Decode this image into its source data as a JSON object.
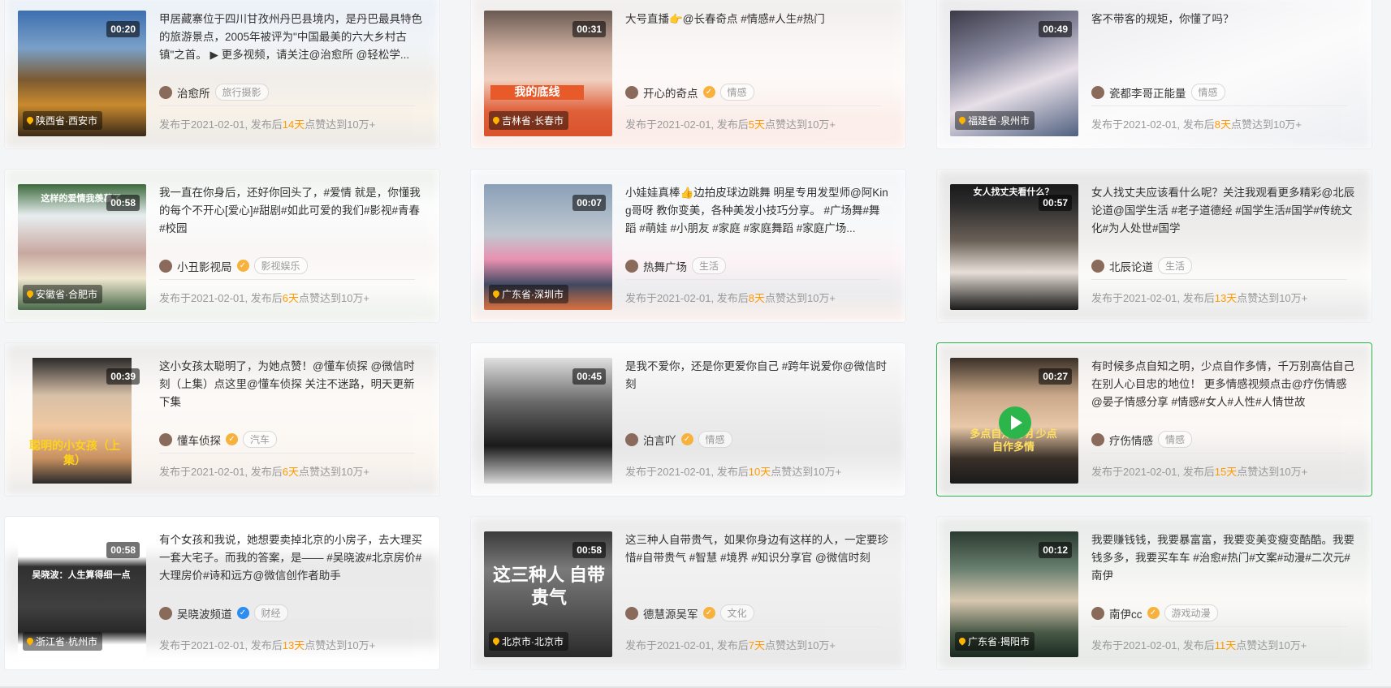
{
  "colors": {
    "accent_green": "#2bb54b",
    "highlight_orange": "#ff9900",
    "location_pin": "#ffb400",
    "verified_gold": "#f6b23c",
    "verified_blue": "#2d8cf0"
  },
  "icons": {
    "location": "location-pin-icon",
    "verified": "verified-badge-icon",
    "play": "play-icon"
  },
  "cards": [
    {
      "duration": "00:20",
      "location": "陕西省·西安市",
      "title": "甲居藏寨位于四川甘孜州丹巴县境内，是丹巴最具特色的旅游景点，2005年被评为\"中国最美的六大乡村古镇\"之首。 ▶ 更多视频，请关注@治愈所 @轻松学...",
      "author": "治愈所",
      "verified": "",
      "tag": "旅行摄影",
      "meta_pre": "发布于2021-02-01, 发布后",
      "days": "14天",
      "meta_post": "点赞达到10万+",
      "thumb_text": ""
    },
    {
      "duration": "00:31",
      "location": "吉林省·长春市",
      "title": "大号直播👉@长春奇点 #情感#人生#热门",
      "author": "开心的奇点",
      "verified": "gold",
      "tag": "情感",
      "meta_pre": "发布于2021-02-01, 发布后",
      "days": "5天",
      "meta_post": "点赞达到10万+",
      "thumb_text": "我的底线"
    },
    {
      "duration": "00:49",
      "location": "福建省·泉州市",
      "title": "客不带客的规矩，你懂了吗？",
      "author": "瓷都李哥正能量",
      "verified": "",
      "tag": "情感",
      "meta_pre": "发布于2021-02-01, 发布后",
      "days": "8天",
      "meta_post": "点赞达到10万+",
      "thumb_text": ""
    },
    {
      "duration": "00:58",
      "location": "安徽省·合肥市",
      "title": "我一直在你身后，还好你回头了，#爱情 就是，你懂我的每个不开心[爱心]#甜剧#如此可爱的我们#影视#青春#校园",
      "author": "小丑影视局",
      "verified": "gold",
      "tag": "影视娱乐",
      "meta_pre": "发布于2021-02-01, 发布后",
      "days": "6天",
      "meta_post": "点赞达到10万+",
      "thumb_text": "这样的爱情我羡慕了"
    },
    {
      "duration": "00:07",
      "location": "广东省·深圳市",
      "title": "小娃娃真棒👍边拍皮球边跳舞 明星专用发型师@阿King哥呀 教你变美，各种美发小技巧分享。 #广场舞#舞蹈 #萌娃 #小朋友 #家庭 #家庭舞蹈 #家庭广场...",
      "author": "热舞广场",
      "verified": "",
      "tag": "生活",
      "meta_pre": "发布于2021-02-01, 发布后",
      "days": "8天",
      "meta_post": "点赞达到10万+",
      "thumb_text": ""
    },
    {
      "duration": "00:57",
      "location": "",
      "title": "女人找丈夫应该看什么呢？关注我观看更多精彩@北辰论道@国学生活 #老子道德经 #国学生活#国学#传统文化#为人处世#国学",
      "author": "北辰论道",
      "verified": "",
      "tag": "生活",
      "meta_pre": "发布于2021-02-01, 发布后",
      "days": "13天",
      "meta_post": "点赞达到10万+",
      "thumb_text": "女人找丈夫看什么？"
    },
    {
      "duration": "00:39",
      "location": "",
      "title": "这小女孩太聪明了，为她点赞！@懂车侦探 @微信时刻（上集）点这里@懂车侦探 关注不迷路，明天更新下集",
      "author": "懂车侦探",
      "verified": "gold",
      "tag": "汽车",
      "meta_pre": "发布于2021-02-01, 发布后",
      "days": "6天",
      "meta_post": "点赞达到10万+",
      "thumb_text": "聪明的小女孩（上集）"
    },
    {
      "duration": "00:45",
      "location": "",
      "title": "是我不爱你，还是你更爱你自己 #跨年说爱你@微信时刻",
      "author": "泊言吖",
      "verified": "gold",
      "tag": "情感",
      "meta_pre": "发布于2021-02-01, 发布后",
      "days": "10天",
      "meta_post": "点赞达到10万+",
      "thumb_text": ""
    },
    {
      "duration": "00:27",
      "location": "",
      "title": "有时候多点自知之明，少点自作多情，千万别高估自己在别人心目忠的地位！ 更多情感视频点击@疗伤情感 @晏子情感分享 #情感#女人#人性#人情世故",
      "author": "疗伤情感",
      "verified": "",
      "tag": "情感",
      "meta_pre": "发布于2021-02-01, 发布后",
      "days": "15天",
      "meta_post": "点赞达到10万+",
      "thumb_text": "多点自知之明 少点自作多情"
    },
    {
      "duration": "00:58",
      "location": "浙江省·杭州市",
      "title": "有个女孩和我说，她想要卖掉北京的小房子，去大理买一套大宅子。而我的答案，是—— #吴晓波#北京房价#大理房价#诗和远方@微信创作者助手",
      "author": "吴晓波频道",
      "verified": "blue",
      "tag": "财经",
      "meta_pre": "发布于2021-02-01, 发布后",
      "days": "13天",
      "meta_post": "点赞达到10万+",
      "thumb_text": "吴晓波：人生算得细一点"
    },
    {
      "duration": "00:58",
      "location": "北京市·北京市",
      "title": "这三种人自带贵气，如果你身边有这样的人，一定要珍惜#自带贵气 #智慧 #境界 #知识分享官 @微信时刻",
      "author": "德慧源吴军",
      "verified": "gold",
      "tag": "文化",
      "meta_pre": "发布于2021-02-01, 发布后",
      "days": "7天",
      "meta_post": "点赞达到10万+",
      "thumb_text": "这三种人 自带贵气"
    },
    {
      "duration": "00:12",
      "location": "广东省·揭阳市",
      "title": "我要赚钱钱，我要暴富富，我要变美变瘦变酷酷。我要钱多多，我要买车车 #治愈#热门#文案#动漫#二次元#南伊",
      "author": "南伊cc",
      "verified": "gold",
      "tag": "游戏动漫",
      "meta_pre": "发布于2021-02-01, 发布后",
      "days": "11天",
      "meta_post": "点赞达到10万+",
      "thumb_text": ""
    }
  ]
}
